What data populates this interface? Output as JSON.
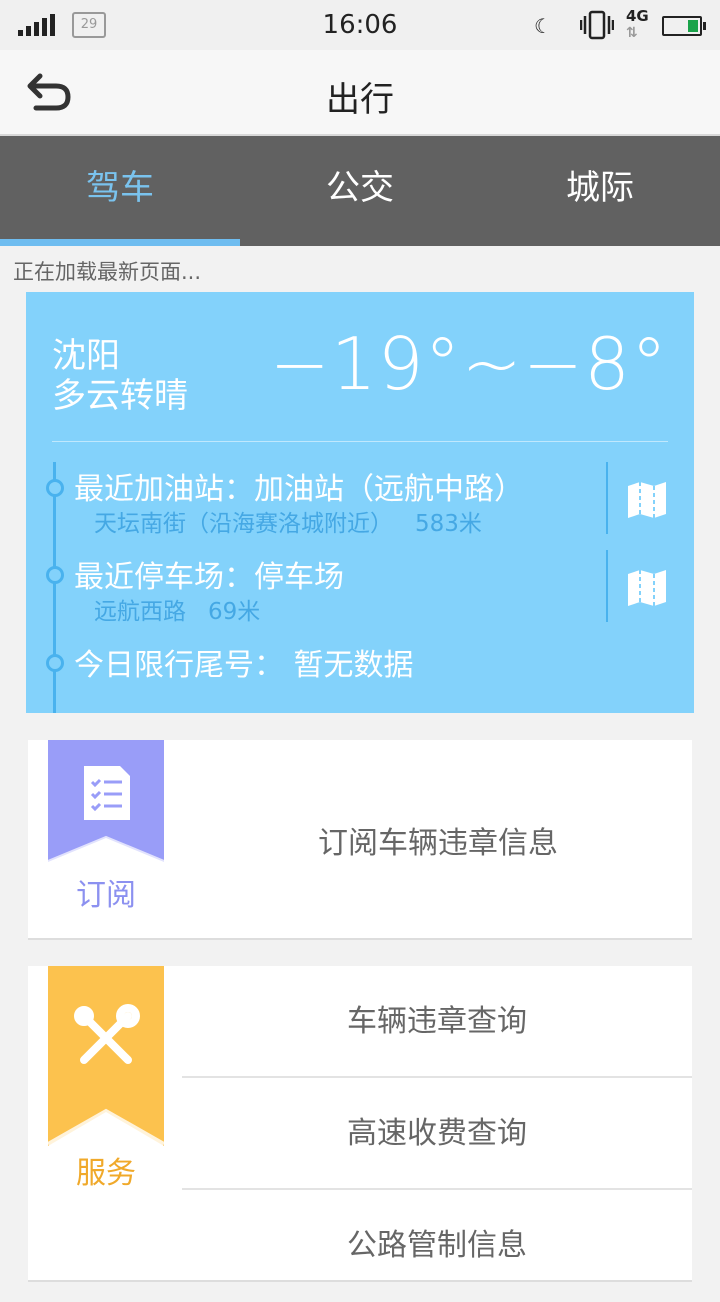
{
  "status_bar": {
    "sim_label": "29",
    "time": "16:06",
    "network": "4G",
    "battery_color": "#1aa34a"
  },
  "header": {
    "title": "出行",
    "back_icon": "back-arrow-icon"
  },
  "tabs": [
    {
      "label": "驾车",
      "active": true
    },
    {
      "label": "公交",
      "active": false
    },
    {
      "label": "城际",
      "active": false
    }
  ],
  "loading_text": "正在加载最新页面...",
  "weather": {
    "city": "沈阳",
    "condition": "多云转晴",
    "temperature": "−19°~−8°",
    "bg_color": "#83d2fb"
  },
  "info": {
    "gas_station": {
      "title": "最近加油站：加油站（远航中路）",
      "address": "天坛南街（沿海赛洛城附近）",
      "distance": "583米"
    },
    "parking": {
      "title": "最近停车场：停车场",
      "address": "远航西路",
      "distance": "69米"
    },
    "restriction": {
      "label": "今日限行尾号：",
      "value": "暂无数据"
    }
  },
  "subscribe": {
    "ribbon_label": "订阅",
    "ribbon_color": "#999df8",
    "item": "订阅车辆违章信息"
  },
  "services": {
    "ribbon_label": "服务",
    "ribbon_color": "#fcc24e",
    "items": [
      "车辆违章查询",
      "高速收费查询",
      "公路管制信息"
    ]
  }
}
